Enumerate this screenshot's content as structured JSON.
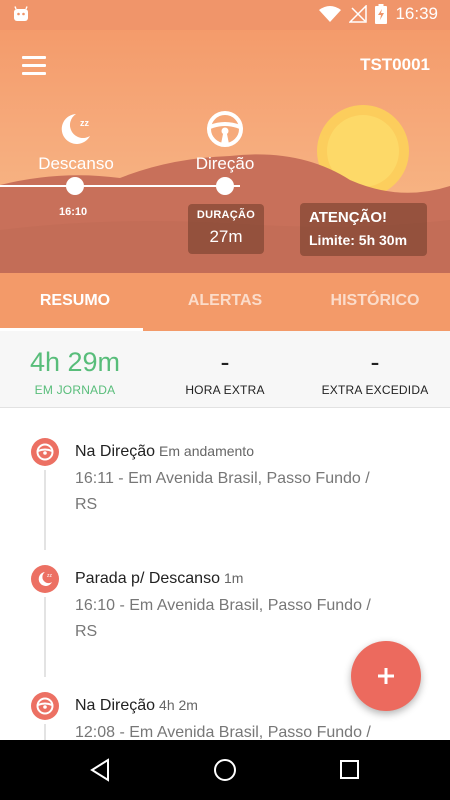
{
  "status_bar": {
    "time": "16:39",
    "icons": [
      "android-icon",
      "wifi-icon",
      "no-signal-icon",
      "battery-charging-icon"
    ]
  },
  "header": {
    "device_id": "TST0001",
    "modes": [
      {
        "label": "Descanso",
        "icon": "moon-sleep-icon"
      },
      {
        "label": "Direção",
        "icon": "steering-wheel-icon"
      }
    ],
    "timeline_time": "16:10",
    "duration": {
      "label": "DURAÇÃO",
      "value": "27m"
    },
    "alert": {
      "title": "ATENÇÃO!",
      "text": "Limite: 5h 30m"
    }
  },
  "tabs": [
    {
      "label": "RESUMO",
      "active": true
    },
    {
      "label": "ALERTAS",
      "active": false
    },
    {
      "label": "HISTÓRICO",
      "active": false
    }
  ],
  "summary": [
    {
      "value": "4h 29m",
      "label": "EM JORNADA"
    },
    {
      "value": "-",
      "label": "HORA EXTRA"
    },
    {
      "value": "-",
      "label": "EXTRA EXCEDIDA"
    }
  ],
  "events": [
    {
      "title": "Na Direção",
      "meta": "Em andamento",
      "desc": "16:11 - Em Avenida Brasil, Passo Fundo / RS",
      "icon": "steering-wheel-icon"
    },
    {
      "title": "Parada p/ Descanso",
      "meta": "1m",
      "desc": "16:10 - Em Avenida Brasil, Passo Fundo / RS",
      "icon": "moon-sleep-icon"
    },
    {
      "title": "Na Direção",
      "meta": "4h 2m",
      "desc": "12:08 - Em Avenida Brasil, Passo Fundo / RS",
      "icon": "steering-wheel-icon"
    }
  ],
  "fab": {
    "label": "+",
    "icon": "plus-icon"
  },
  "colors": {
    "accent": "#ec6a5e",
    "header": "#f39a69",
    "highlight": "#58bd7a"
  }
}
